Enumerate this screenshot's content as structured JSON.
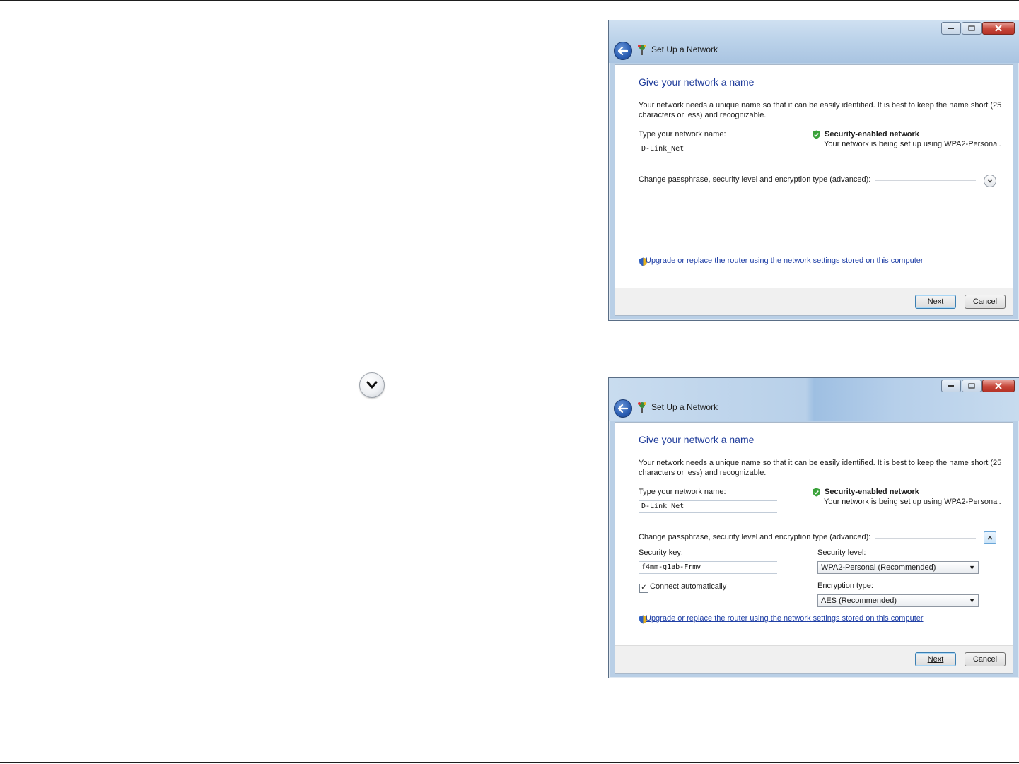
{
  "window_title": "Set Up a Network",
  "page": {
    "heading": "Give your network a name",
    "description": "Your network needs a unique name so that it can be easily identified. It is best to keep the name short (25 characters or less) and recognizable.",
    "network_name_label": "Type your network name:",
    "network_name_value": "D-Link_Net",
    "security_title": "Security-enabled network",
    "security_desc": "Your network is being set up using WPA2-Personal.",
    "advanced_label": "Change passphrase, security level and encryption type (advanced):",
    "upgrade_link": "Upgrade or replace the router using the network settings stored on this computer"
  },
  "advanced": {
    "security_key_label": "Security key:",
    "security_key_value": "f4mm-g1ab-Frmv",
    "security_level_label": "Security level:",
    "security_level_value": "WPA2-Personal (Recommended)",
    "connect_auto_label": "Connect automatically",
    "connect_auto_checked": true,
    "encryption_label": "Encryption type:",
    "encryption_value": "AES (Recommended)"
  },
  "buttons": {
    "next": "Next",
    "cancel": "Cancel"
  },
  "icons": {
    "expand": "chevron-down-icon",
    "collapse": "chevron-up-icon",
    "back": "back-arrow-icon",
    "network": "network-icon",
    "shield": "shield-check-icon",
    "uac": "uac-shield-icon"
  }
}
